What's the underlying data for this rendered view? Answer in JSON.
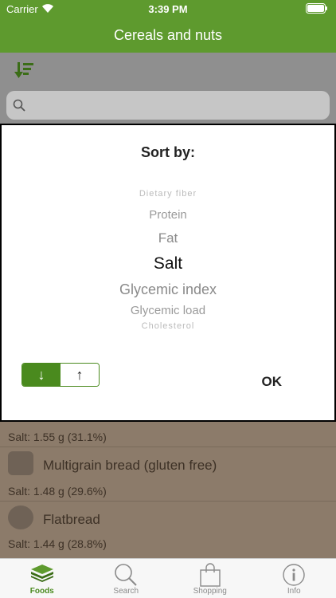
{
  "status": {
    "carrier": "Carrier",
    "time": "3:39 PM"
  },
  "nav": {
    "title": "Cereals and nuts"
  },
  "search": {
    "placeholder": ""
  },
  "list": [
    {
      "salt": "Salt: 1.55 g (31.1%)"
    },
    {
      "name": "Multigrain bread (gluten free)",
      "salt": "Salt: 1.48 g (29.6%)"
    },
    {
      "name": "Flatbread",
      "salt": "Salt: 1.44 g (28.8%)"
    }
  ],
  "dialog": {
    "title": "Sort by:",
    "picker": [
      "Dietary fiber",
      "Protein",
      "Fat",
      "Salt",
      "Glycemic index",
      "Glycemic load",
      "Cholesterol"
    ],
    "selected": "Salt",
    "desc_label": "↓",
    "asc_label": "↑",
    "ok_label": "OK"
  },
  "tabs": [
    {
      "label": "Foods",
      "icon": "foods-icon",
      "active": true
    },
    {
      "label": "Search",
      "icon": "search-icon",
      "active": false
    },
    {
      "label": "Shopping",
      "icon": "shopping-bag-icon",
      "active": false
    },
    {
      "label": "Info",
      "icon": "info-icon",
      "active": false
    }
  ],
  "colors": {
    "brand": "#5e9a2e",
    "accent": "#4a8a1e"
  }
}
